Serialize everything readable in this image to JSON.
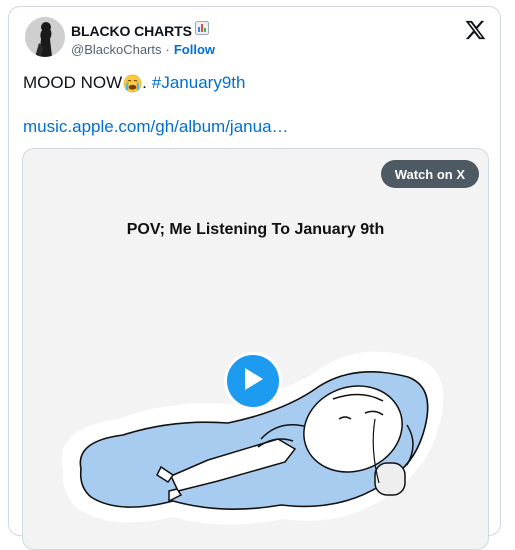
{
  "author": {
    "name": "BLACKO CHARTS",
    "name_emoji": "📊",
    "handle": "@BlackoCharts",
    "separator": "·",
    "follow_label": "Follow"
  },
  "tweet": {
    "text": "MOOD NOW",
    "emoji": "😭",
    "punctuation": ".",
    "hashtag": "#January9th",
    "link": "music.apple.com/gh/album/janua…"
  },
  "media": {
    "watch_label": "Watch on X",
    "caption": "POV; Me Listening To January 9th"
  },
  "colors": {
    "link": "#006fd6",
    "play": "#1d9bf0",
    "puddle": "#a8ccf0"
  },
  "icons": {
    "platform": "x-logo-icon",
    "play": "play-icon"
  }
}
